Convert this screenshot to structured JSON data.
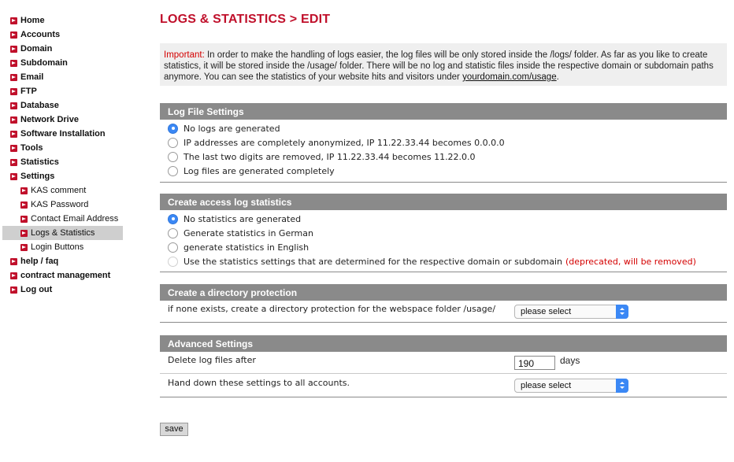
{
  "sidebar": {
    "items": [
      {
        "label": "Home"
      },
      {
        "label": "Accounts"
      },
      {
        "label": "Domain"
      },
      {
        "label": "Subdomain"
      },
      {
        "label": "Email"
      },
      {
        "label": "FTP"
      },
      {
        "label": "Database"
      },
      {
        "label": "Network Drive"
      },
      {
        "label": "Software Installation"
      },
      {
        "label": "Tools"
      },
      {
        "label": "Statistics"
      },
      {
        "label": "Settings"
      }
    ],
    "settings_subitems": [
      {
        "label": "KAS comment"
      },
      {
        "label": "KAS Password"
      },
      {
        "label": "Contact Email Address"
      },
      {
        "label": "Logs & Statistics",
        "active": true
      },
      {
        "label": "Login Buttons"
      }
    ],
    "bottom_items": [
      {
        "label": "help / faq"
      },
      {
        "label": "contract management"
      },
      {
        "label": "Log out"
      }
    ]
  },
  "page": {
    "title": "LOGS & STATISTICS > EDIT"
  },
  "notice": {
    "important_label": "Important:",
    "text": " In order to make the handling of logs easier, the log files will be only stored inside the /logs/ folder. As far as you like to create statistics, it will be stored inside the /usage/ folder. There will be no log and statistic files inside the respective domain or subdomain paths anymore. You can see the statistics of your website hits and visitors under ",
    "link_text": "yourdomain.com/usage",
    "trailing": "."
  },
  "log_file_settings": {
    "heading": "Log File Settings",
    "options": [
      {
        "label": "No logs are generated",
        "checked": true
      },
      {
        "label": "IP addresses are completely anonymized, IP 11.22.33.44 becomes 0.0.0.0",
        "checked": false
      },
      {
        "label": "The last two digits are removed, IP 11.22.33.44 becomes 11.22.0.0",
        "checked": false
      },
      {
        "label": "Log files are generated completely",
        "checked": false
      }
    ]
  },
  "access_log_statistics": {
    "heading": "Create access log statistics",
    "options": [
      {
        "label": "No statistics are generated",
        "checked": true
      },
      {
        "label": "Generate statistics in German",
        "checked": false
      },
      {
        "label": "generate statistics in English",
        "checked": false
      },
      {
        "label": "Use the statistics settings that are determined for the respective domain or subdomain",
        "checked": false,
        "note": "(deprecated, will be removed)"
      }
    ]
  },
  "directory_protection": {
    "heading": "Create a directory protection",
    "label": "if none exists, create a directory protection for the webspace folder /usage/",
    "select_value": "please select"
  },
  "advanced_settings": {
    "heading": "Advanced Settings",
    "delete_label": "Delete log files after",
    "delete_value": "190",
    "delete_unit": "days",
    "hand_down_label": "Hand down these settings to all accounts.",
    "hand_down_select_value": "please select"
  },
  "actions": {
    "save_label": "save"
  },
  "colors": {
    "accent": "#c0102b",
    "section_header": "#8a8a8a",
    "notice_bg": "#efefef",
    "radio_checked": "#3b88f5",
    "warning_text": "#d40000"
  }
}
